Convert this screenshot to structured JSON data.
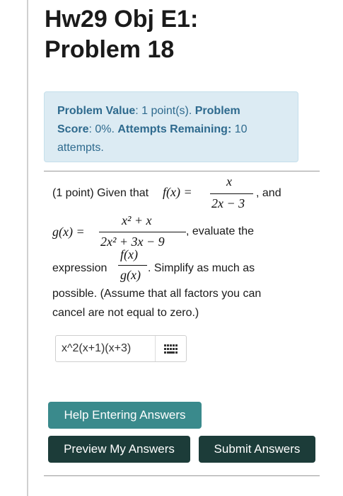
{
  "page": {
    "title_line1": "Hw29 Obj E1:",
    "title_line2": "Problem 18"
  },
  "info": {
    "value_label": "Problem Value",
    "value_text": ": 1 point(s). ",
    "score_label_a": "Problem",
    "score_label_b": "Score",
    "score_text": ": 0%. ",
    "attempts_label": "Attempts Remaining:",
    "attempts_count": " 10",
    "attempts_unit": "attempts."
  },
  "problem": {
    "intro": "(1 point) Given that ",
    "f_of_x": "f(x) =",
    "f_num": "x",
    "f_den": "2x − 3",
    "and": ", and",
    "g_of_x": "g(x) =",
    "g_num": "x² + x",
    "g_den": "2x² + 3x − 9",
    "evaluate": ", evaluate the",
    "expression": "expression",
    "ratio_num": "f(x)",
    "ratio_den": "g(x)",
    "simplify": ". Simplify as much as",
    "assume_line1": "possible. (Assume that all factors you can",
    "assume_line2": "cancel are not equal to zero.)"
  },
  "answer": {
    "value": "x^2(x+1)(x+3)",
    "icon": "keyboard-grid-icon"
  },
  "buttons": {
    "help": "Help Entering Answers",
    "preview": "Preview My Answers",
    "submit": "Submit Answers"
  }
}
